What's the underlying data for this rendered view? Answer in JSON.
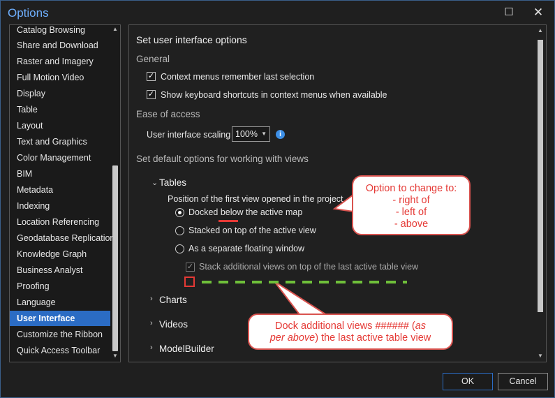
{
  "window": {
    "title": "Options",
    "maximize_glyph": "☐",
    "close_glyph": "✕"
  },
  "nav": {
    "items": [
      "Catalog Browsing",
      "Share and Download",
      "Raster and Imagery",
      "Full Motion Video",
      "Display",
      "Table",
      "Layout",
      "Text and Graphics",
      "Color Management",
      "BIM",
      "Metadata",
      "Indexing",
      "Location Referencing",
      "Geodatabase Replication",
      "Knowledge Graph",
      "Business Analyst",
      "Proofing",
      "Language",
      "User Interface",
      "Customize the Ribbon",
      "Quick Access Toolbar"
    ],
    "selected": "User Interface"
  },
  "content": {
    "heading": "Set user interface options",
    "general": {
      "title": "General",
      "option1": "Context menus remember last selection",
      "option2": "Show keyboard shortcuts in context menus when available"
    },
    "ease": {
      "title": "Ease of access",
      "scaling_label": "User interface scaling",
      "scaling_value": "100%"
    },
    "views": {
      "title": "Set default options for working with views",
      "tables_label": "Tables",
      "position_label": "Position of the first view opened in the project",
      "radio1": "Docked below the active map",
      "radio2": "Stacked on top of the active view",
      "radio3": "As a separate floating window",
      "stack_label": "Stack additional views on top of the last active table view",
      "charts_label": "Charts",
      "videos_label": "Videos",
      "modelbuilder_label": "ModelBuilder"
    }
  },
  "annotations": {
    "callout1": [
      "Option to change to:",
      "- right of",
      "- left of",
      "- above"
    ],
    "callout2_line1": "Dock additional views ###### (",
    "callout2_italic1": "as",
    "callout2_italic2": "per above",
    "callout2_line2_rest": ") the last active table view",
    "colors": {
      "red": "#e53935",
      "green": "#6fbf3a"
    }
  },
  "footer": {
    "ok_label": "OK",
    "cancel_label": "Cancel"
  },
  "icons": [
    "maximize-icon",
    "close-icon",
    "checkmark-icon",
    "info-icon",
    "chevron-down-icon",
    "chevron-right-icon",
    "scroll-up-icon",
    "scroll-down-icon"
  ]
}
